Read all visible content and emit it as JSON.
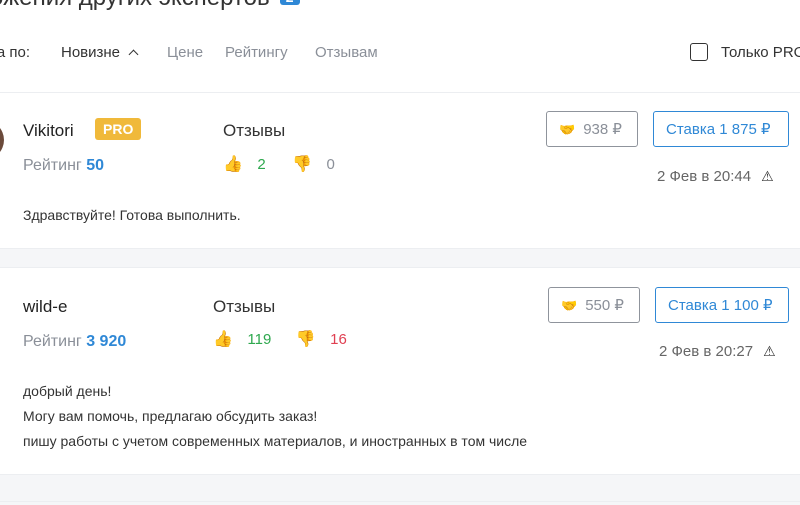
{
  "header": {
    "title": "ожения других экспертов",
    "count": "2"
  },
  "sort": {
    "label": "ка по:",
    "options": [
      "Новизне",
      "Цене",
      "Рейтингу",
      "Отзывам"
    ]
  },
  "filter": {
    "pro_only_label": "Только PRO"
  },
  "bids": [
    {
      "user": "Vikitori",
      "pro": "PRO",
      "rating_label": "Рейтинг",
      "rating_value": "50",
      "reviews_label": "Отзывы",
      "likes": "2",
      "dislikes": "0",
      "price": "938 ₽",
      "bid": "Ставка 1 875 ₽",
      "date": "2 Фев в 20:44",
      "message": [
        "Здравствуйте! Готова выполнить."
      ]
    },
    {
      "user": "wild-e",
      "rating_label": "Рейтинг",
      "rating_value": "3 920",
      "reviews_label": "Отзывы",
      "likes": "119",
      "dislikes": "16",
      "price": "550 ₽",
      "bid": "Ставка 1 100 ₽",
      "date": "2 Фев в 20:27",
      "message": [
        "добрый день!",
        "Могу вам помочь, предлагаю обсудить заказ!",
        "пишу работы с учетом современных материалов, и иностранных в том числе"
      ]
    }
  ],
  "colors": {
    "accent": "#2f88d6",
    "pro": "#f0b93a",
    "like": "#2ea84e",
    "dislike": "#e04052"
  }
}
